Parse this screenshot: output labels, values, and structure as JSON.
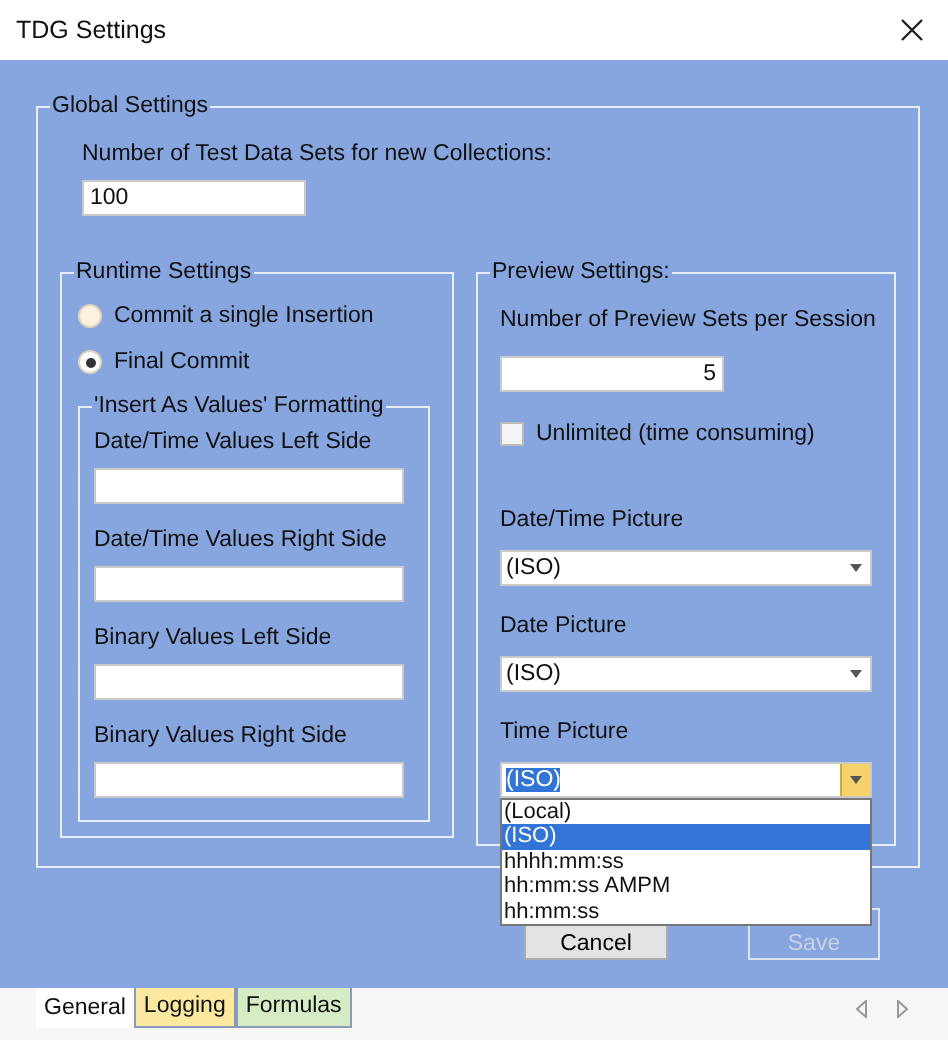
{
  "window": {
    "title": "TDG Settings"
  },
  "global_settings": {
    "legend": "Global Settings",
    "label": "Number of Test Data Sets for new Collections:",
    "value": "100"
  },
  "runtime_settings": {
    "legend": "Runtime Settings",
    "options": [
      {
        "label": "Commit a single Insertion",
        "selected": false
      },
      {
        "label": "Final Commit",
        "selected": true
      }
    ],
    "formatting": {
      "legend": "'Insert As Values' Formatting",
      "fields": [
        {
          "label": "Date/Time Values Left Side"
        },
        {
          "label": "Date/Time Values Right Side"
        },
        {
          "label": "Binary Values Left Side"
        },
        {
          "label": "Binary Values Right Side"
        }
      ]
    }
  },
  "preview_settings": {
    "legend": "Preview Settings:",
    "sets_label": "Number of Preview Sets per Session",
    "sets_value": "5",
    "unlimited": {
      "label": "Unlimited (time consuming)",
      "checked": false
    },
    "pictures": [
      {
        "label": "Date/Time Picture",
        "value": "(ISO)",
        "open": false
      },
      {
        "label": "Date Picture",
        "value": "(ISO)",
        "open": false
      },
      {
        "label": "Time Picture",
        "value": "(ISO)",
        "open": true
      }
    ],
    "dropdown_options": [
      {
        "label": "(Local)",
        "selected": false
      },
      {
        "label": "(ISO)",
        "selected": true
      },
      {
        "label": "hhhh:mm:ss",
        "selected": false
      },
      {
        "label": "hh:mm:ss AMPM",
        "selected": false
      },
      {
        "label": "hh:mm:ss",
        "selected": false
      }
    ]
  },
  "buttons": [
    {
      "label": "Cancel",
      "disabled": false
    },
    {
      "label": "Save",
      "disabled": true
    }
  ],
  "tabs": [
    {
      "label": "General",
      "selected": true,
      "color": "#ffffff"
    },
    {
      "label": "Logging",
      "selected": false,
      "color": "#fbe9a0"
    },
    {
      "label": "Formulas",
      "selected": false,
      "color": "#d6ecc4"
    }
  ]
}
